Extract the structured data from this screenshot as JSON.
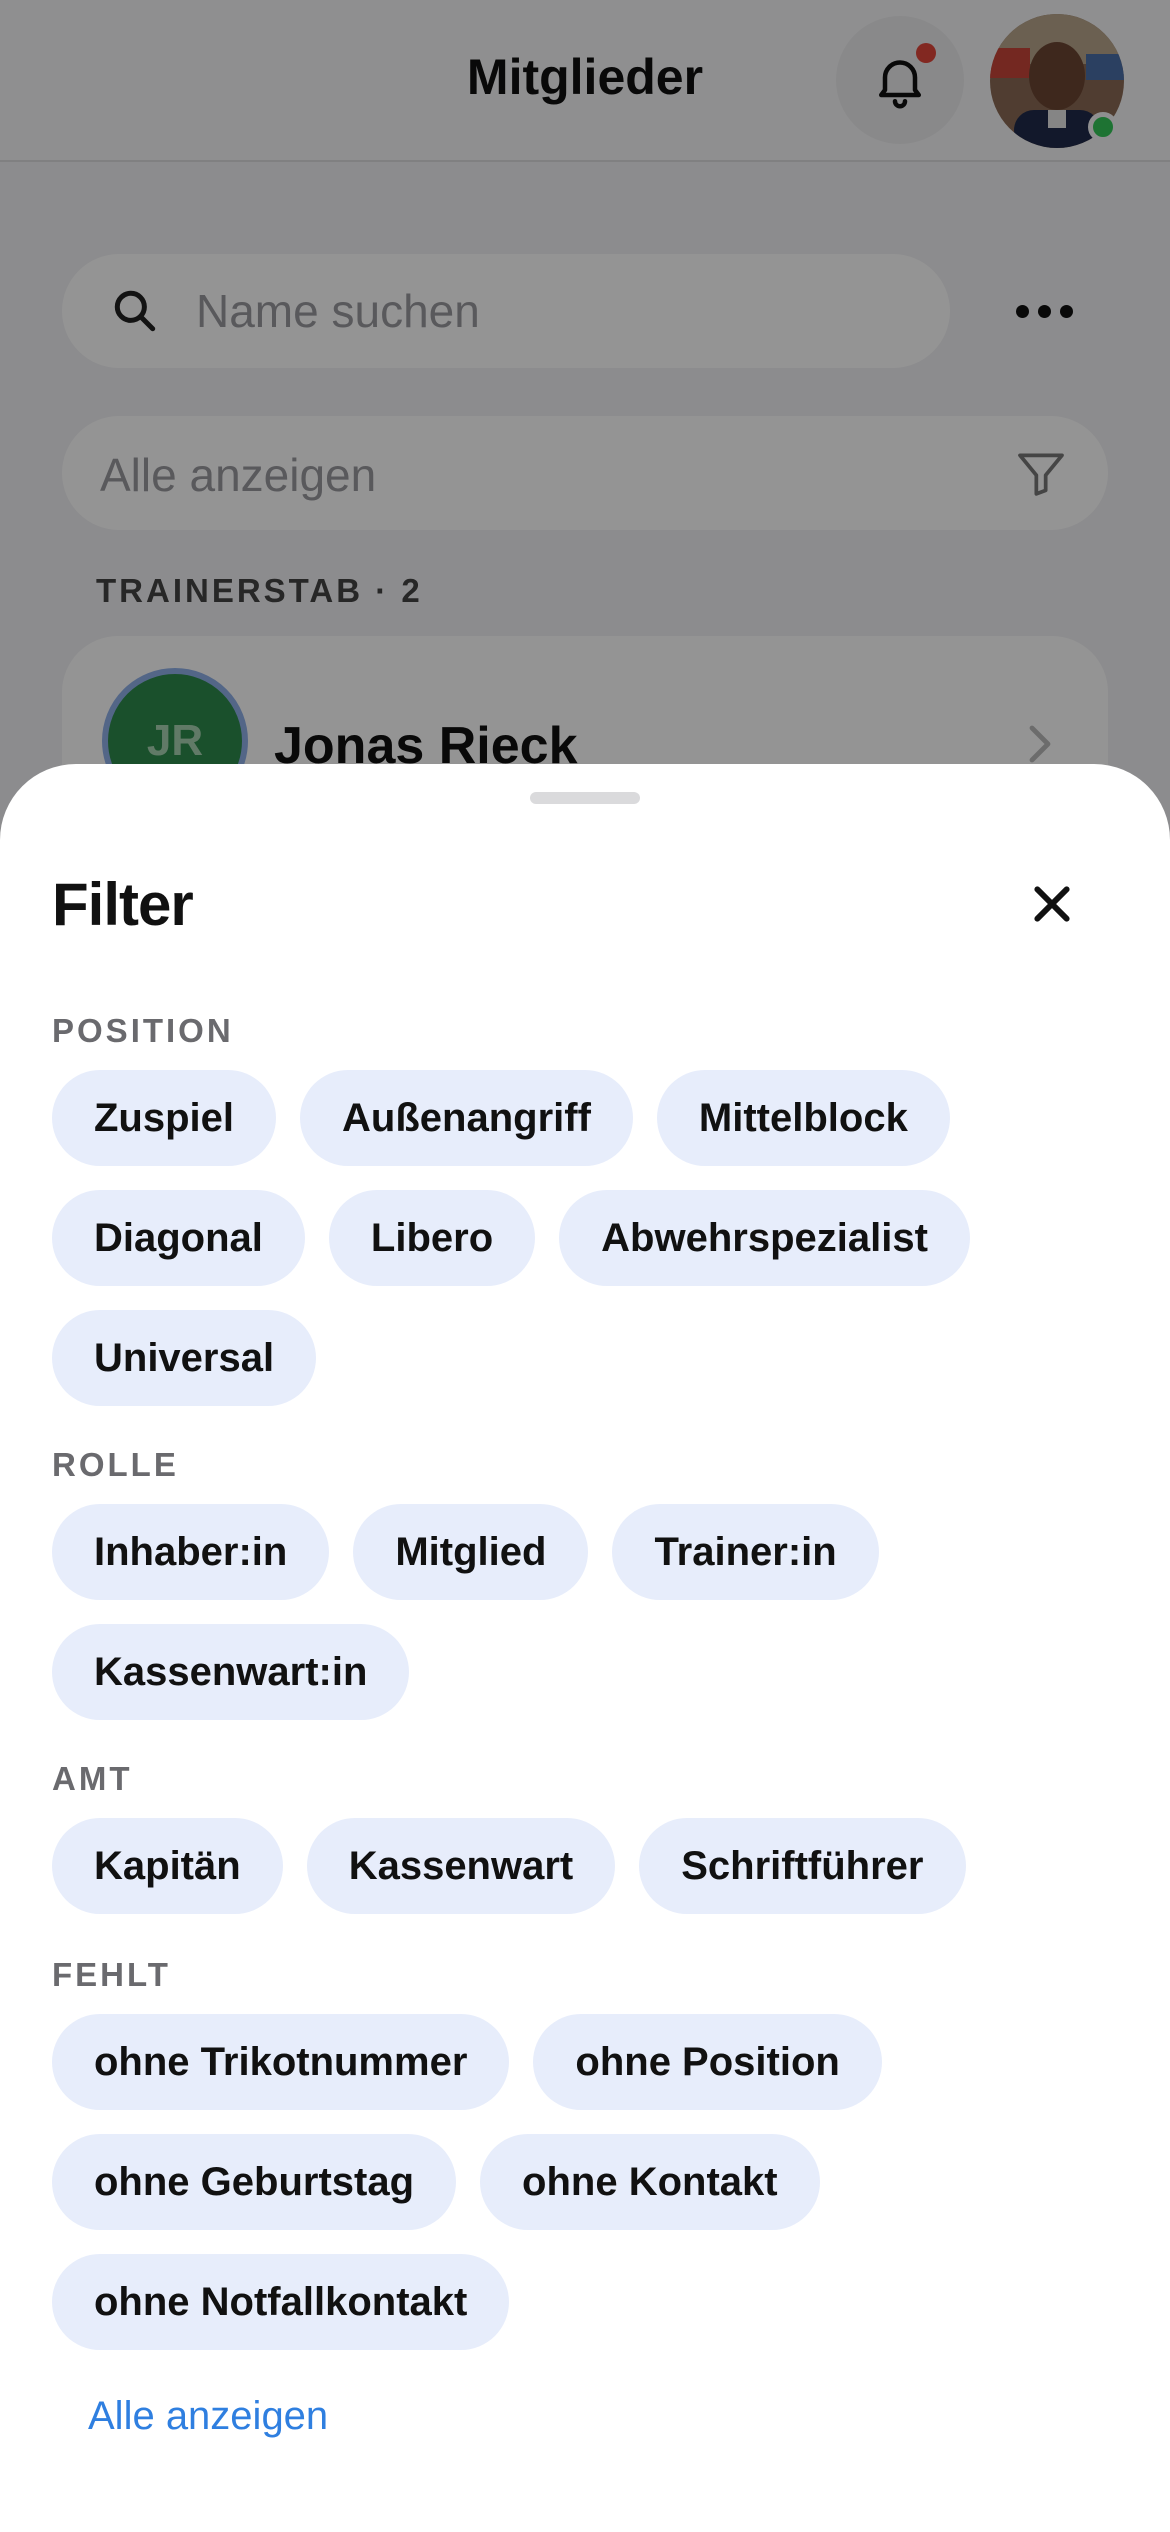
{
  "header": {
    "title": "Mitglieder"
  },
  "search": {
    "placeholder": "Name suchen"
  },
  "filter_select": {
    "label": "Alle anzeigen"
  },
  "trainerstab": {
    "section_label": "TRAINERSTAB · 2"
  },
  "member": {
    "initials": "JR",
    "name": "Jonas Rieck"
  },
  "sheet": {
    "title": "Filter",
    "groups": [
      {
        "label": "POSITION",
        "chips": [
          "Zuspiel",
          "Außenangriff",
          "Mittelblock",
          "Diagonal",
          "Libero",
          "Abwehrspezialist",
          "Universal"
        ]
      },
      {
        "label": "ROLLE",
        "chips": [
          "Inhaber:in",
          "Mitglied",
          "Trainer:in",
          "Kassenwart:in"
        ]
      },
      {
        "label": "AMT",
        "chips": [
          "Kapitän",
          "Kassenwart",
          "Schriftführer"
        ]
      },
      {
        "label": "FEHLT",
        "chips": [
          "ohne Trikotnummer",
          "ohne Position",
          "ohne Geburtstag",
          "ohne Kontakt",
          "ohne Notfallkontakt"
        ]
      }
    ],
    "show_all": "Alle anzeigen"
  },
  "colors": {
    "chip_bg": "#e7edfb",
    "link": "#2f7fe0",
    "notification_dot": "#e0453a",
    "online": "#34c759",
    "member_avatar": "#2e8a4c"
  },
  "icons": [
    "bell-icon",
    "search-icon",
    "more-icon",
    "filter-funnel-icon",
    "chevron-right-icon",
    "close-icon"
  ]
}
